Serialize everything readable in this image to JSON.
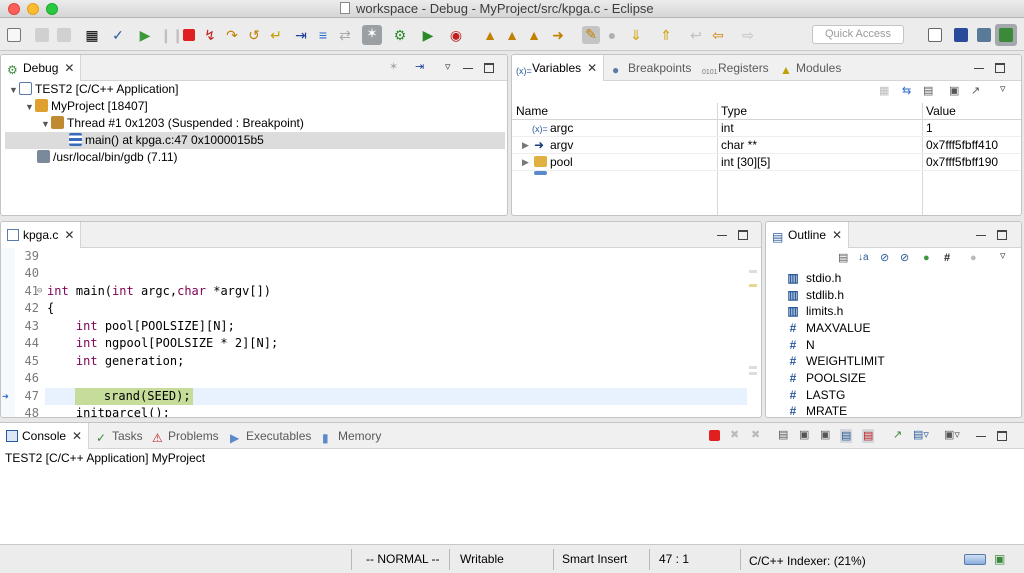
{
  "window": {
    "title": "workspace - Debug - MyProject/src/kpga.c - Eclipse"
  },
  "toolbar": {
    "quick_access_placeholder": "Quick Access"
  },
  "debug_view": {
    "tab_label": "Debug",
    "tree": [
      {
        "label": "TEST2 [C/C++ Application]"
      },
      {
        "label": "MyProject [18407]"
      },
      {
        "label": "Thread #1 0x1203 (Suspended : Breakpoint)"
      },
      {
        "label": "main() at kpga.c:47 0x1000015b5"
      },
      {
        "label": "/usr/local/bin/gdb (7.11)"
      }
    ]
  },
  "variables_view": {
    "tabs": [
      {
        "label": "Variables"
      },
      {
        "label": "Breakpoints"
      },
      {
        "label": "Registers"
      },
      {
        "label": "Modules"
      }
    ],
    "columns": [
      "Name",
      "Type",
      "Value"
    ],
    "rows": [
      {
        "name": "argc",
        "type": "int",
        "value": "1"
      },
      {
        "name": "argv",
        "type": "char **",
        "value": "0x7fff5fbff410"
      },
      {
        "name": "pool",
        "type": "int [30][5]",
        "value": "0x7fff5fbff190"
      }
    ]
  },
  "editor": {
    "tab_label": "kpga.c",
    "lines": [
      {
        "num": "39",
        "text": ""
      },
      {
        "num": "40",
        "text": ""
      },
      {
        "num": "41",
        "text": "int main(int argc,char *argv[])"
      },
      {
        "num": "42",
        "text": "{"
      },
      {
        "num": "43",
        "text": "    int pool[POOLSIZE][N];"
      },
      {
        "num": "44",
        "text": "    int ngpool[POOLSIZE * 2][N];"
      },
      {
        "num": "45",
        "text": "    int generation;"
      },
      {
        "num": "46",
        "text": ""
      },
      {
        "num": "47",
        "text": "    srand(SEED);"
      },
      {
        "num": "48",
        "text": "    initparcel();"
      }
    ]
  },
  "outline_view": {
    "tab_label": "Outline",
    "items": [
      {
        "label": "stdio.h",
        "kind": "include"
      },
      {
        "label": "stdlib.h",
        "kind": "include"
      },
      {
        "label": "limits.h",
        "kind": "include"
      },
      {
        "label": "MAXVALUE",
        "kind": "macro"
      },
      {
        "label": "N",
        "kind": "macro"
      },
      {
        "label": "WEIGHTLIMIT",
        "kind": "macro"
      },
      {
        "label": "POOLSIZE",
        "kind": "macro"
      },
      {
        "label": "LASTG",
        "kind": "macro"
      },
      {
        "label": "MRATE",
        "kind": "macro"
      }
    ]
  },
  "console_view": {
    "tabs": [
      {
        "label": "Console"
      },
      {
        "label": "Tasks"
      },
      {
        "label": "Problems"
      },
      {
        "label": "Executables"
      },
      {
        "label": "Memory"
      }
    ],
    "output": "TEST2 [C/C++ Application] MyProject"
  },
  "status_bar": {
    "mode": "-- NORMAL --",
    "writable": "Writable",
    "insert_mode": "Smart Insert",
    "position": "47 : 1",
    "indexer": "C/C++ Indexer: (21%)"
  },
  "colors": {
    "current_line_highlight": "#c6dc9b",
    "keyword": "#7f0055",
    "stop_button": "#e02020"
  }
}
